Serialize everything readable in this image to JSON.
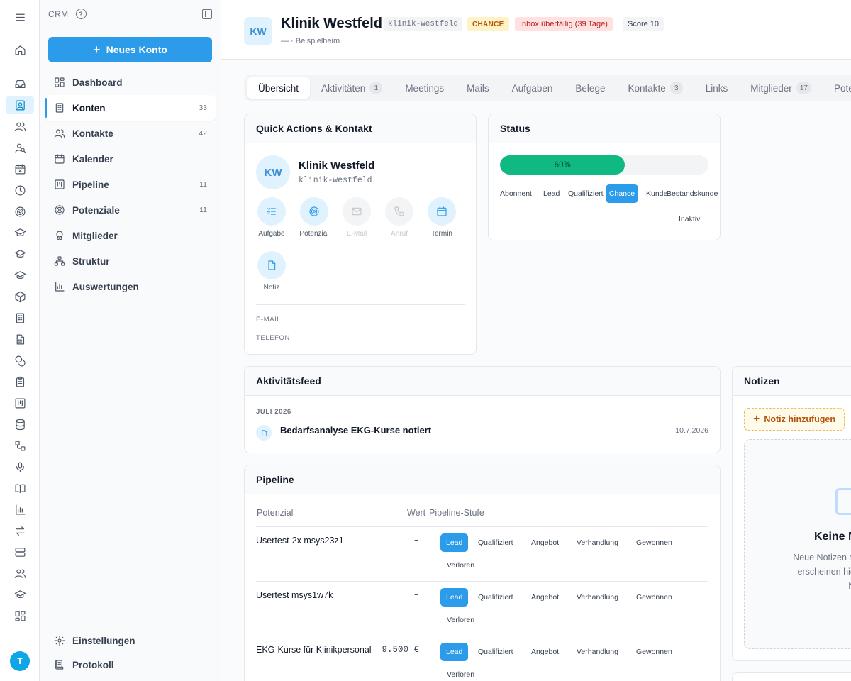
{
  "app": {
    "section": "CRM",
    "help_icon": "help-circle-icon",
    "collapse_icon": "sidebar-collapse-icon"
  },
  "user": {
    "initial": "T"
  },
  "sidebar": {
    "new_button": "Neues Konto",
    "items": [
      {
        "label": "Dashboard",
        "icon": "dashboard-icon",
        "count": ""
      },
      {
        "label": "Konten",
        "icon": "building-icon",
        "count": "33"
      },
      {
        "label": "Kontakte",
        "icon": "users-icon",
        "count": "42"
      },
      {
        "label": "Kalender",
        "icon": "calendar-icon",
        "count": ""
      },
      {
        "label": "Pipeline",
        "icon": "kanban-icon",
        "count": "11"
      },
      {
        "label": "Potenziale",
        "icon": "target-icon",
        "count": "11"
      },
      {
        "label": "Mitglieder",
        "icon": "award-icon",
        "count": ""
      },
      {
        "label": "Struktur",
        "icon": "hierarchy-icon",
        "count": ""
      },
      {
        "label": "Auswertungen",
        "icon": "bar-chart-icon",
        "count": ""
      }
    ],
    "footer": [
      {
        "label": "Einstellungen",
        "icon": "gear-icon"
      },
      {
        "label": "Protokoll",
        "icon": "log-icon"
      }
    ]
  },
  "header": {
    "initials": "KW",
    "title": "Klinik Westfeld",
    "slug": "klinik-westfeld",
    "badge_chance": "CHANCE",
    "badge_overdue": "Inbox überfällig (39 Tage)",
    "score": "Score 10",
    "subtitle": "— · Beispielheim"
  },
  "tabs": [
    {
      "label": "Übersicht",
      "count": ""
    },
    {
      "label": "Aktivitäten",
      "count": "1"
    },
    {
      "label": "Meetings",
      "count": ""
    },
    {
      "label": "Mails",
      "count": ""
    },
    {
      "label": "Aufgaben",
      "count": ""
    },
    {
      "label": "Belege",
      "count": ""
    },
    {
      "label": "Kontakte",
      "count": "3"
    },
    {
      "label": "Links",
      "count": ""
    },
    {
      "label": "Mitglieder",
      "count": "17"
    },
    {
      "label": "Pote",
      "count": ""
    }
  ],
  "quick": {
    "title": "Quick Actions & Kontakt",
    "initials": "KW",
    "name": "Klinik Westfeld",
    "slug": "klinik-westfeld",
    "actions": [
      {
        "label": "Aufgabe",
        "icon": "task-list-icon",
        "enabled": true
      },
      {
        "label": "Potenzial",
        "icon": "target-icon",
        "enabled": true
      },
      {
        "label": "E-Mail",
        "icon": "mail-icon",
        "enabled": false
      },
      {
        "label": "Anruf",
        "icon": "phone-icon",
        "enabled": false
      },
      {
        "label": "Termin",
        "icon": "calendar-icon",
        "enabled": true
      },
      {
        "label": "Notiz",
        "icon": "note-icon",
        "enabled": true
      }
    ],
    "email_label": "E-MAIL",
    "phone_label": "TELEFON"
  },
  "status": {
    "title": "Status",
    "progress": 0.6,
    "progress_label": "60%",
    "stages": [
      "Abonnent",
      "Lead",
      "Qualifiziert",
      "Chance",
      "Kunde",
      "Bestandskunde",
      "Inaktiv"
    ],
    "active_stage": "Chance"
  },
  "activity": {
    "title": "Aktivitätsfeed",
    "month": "JULI 2026",
    "items": [
      {
        "title": "Bedarfsanalyse EKG-Kurse notiert",
        "date": "10.7.2026",
        "icon": "note-icon"
      }
    ]
  },
  "pipeline": {
    "title": "Pipeline",
    "col_potential": "Potenzial",
    "col_value": "Wert",
    "col_stage": "Pipeline-Stufe",
    "stages": [
      "Lead",
      "Qualifiziert",
      "Angebot",
      "Verhandlung",
      "Gewonnen",
      "Verloren"
    ],
    "rows": [
      {
        "name": "Usertest-2x msys23z1",
        "value": "–",
        "stage": "Lead"
      },
      {
        "name": "Usertest msys1w7k",
        "value": "–",
        "stage": "Lead"
      },
      {
        "name": "EKG-Kurse für Klinikpersonal",
        "value": "9.500 €",
        "stage": "Lead"
      }
    ]
  },
  "notes": {
    "title": "Notizen",
    "add_button": "Notiz hinzufügen",
    "empty_title": "Keine N",
    "empty_text_1": "Neue Notizen aus d",
    "empty_text_2": "erscheinen hier für",
    "empty_text_3": "Nutz"
  },
  "colors": {
    "accent": "#2b9bea",
    "progress": "#10b981",
    "chance_bg": "#fef3c7",
    "overdue_bg": "#fee2e2"
  }
}
